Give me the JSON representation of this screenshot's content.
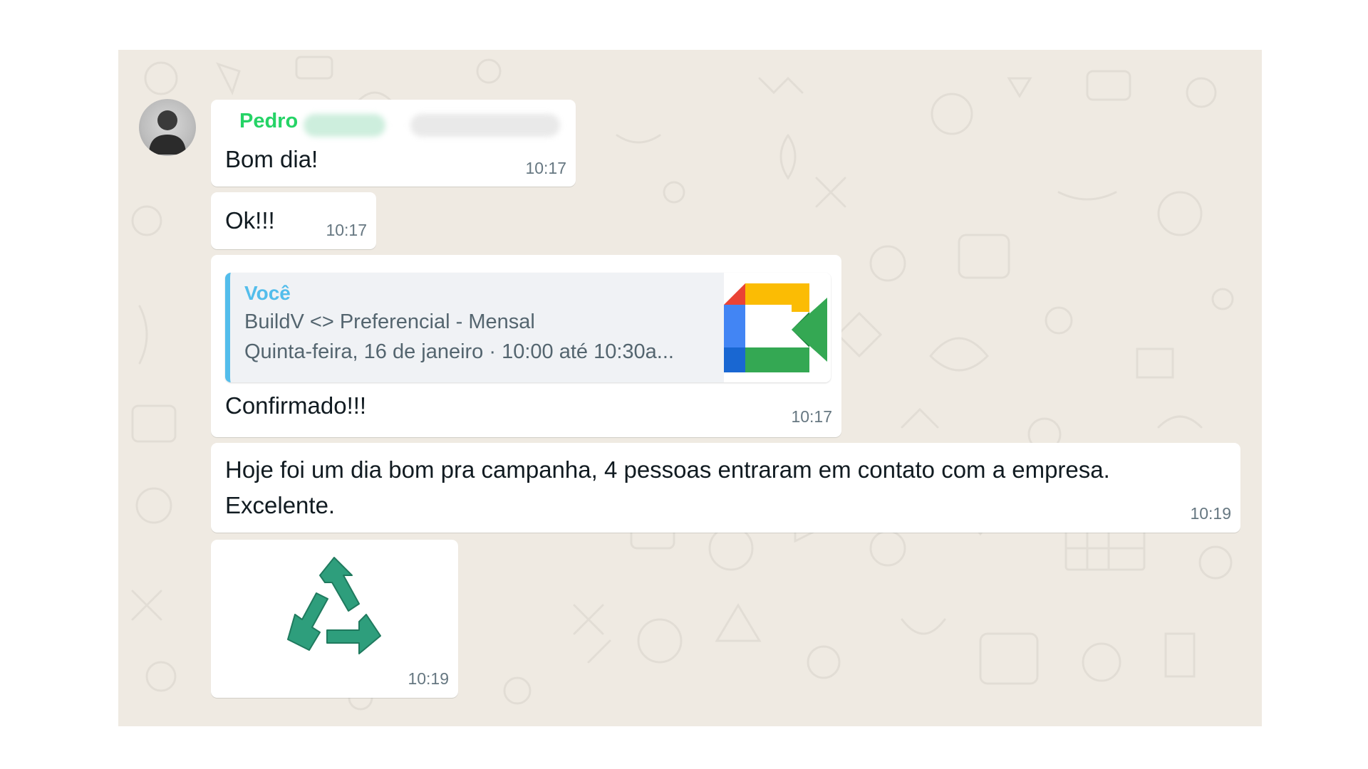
{
  "chat": {
    "messages": [
      {
        "sender": "Pedro",
        "text": "Bom dia!",
        "time": "10:17"
      },
      {
        "text": "Ok!!!",
        "time": "10:17"
      },
      {
        "quote": {
          "author": "Você",
          "title": "BuildV <> Preferencial - Mensal",
          "subtitle": "Quinta-feira, 16 de janeiro · 10:00 até 10:30a..."
        },
        "text": "Confirmado!!!",
        "time": "10:17"
      },
      {
        "text_line1": "Hoje foi um dia bom pra campanha, 4 pessoas entraram em contato com a empresa.",
        "text_line2": "Excelente.",
        "time": "10:19"
      },
      {
        "sticker": "recycle-icon",
        "time": "10:19"
      }
    ]
  },
  "colors": {
    "wallpaper": "#efeae2",
    "sender_name": "#25d366",
    "quote_bar": "#53bdeb",
    "timestamp": "#667781",
    "sticker": "#2e9e7c"
  }
}
